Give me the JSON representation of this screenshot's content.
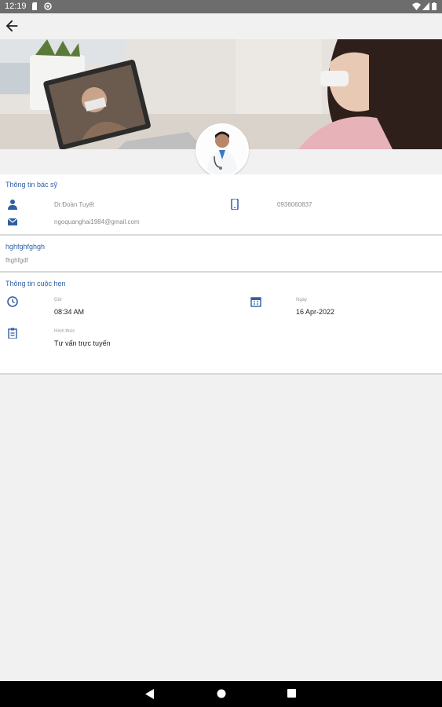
{
  "status_bar": {
    "time": "12:19",
    "icons": [
      "sd-card-icon",
      "data-saver-icon",
      "wifi-icon",
      "signal-icon",
      "battery-icon"
    ]
  },
  "app_bar": {
    "back_icon": "arrow-back-icon"
  },
  "banner": {
    "description_icon": "telemedicine-photo"
  },
  "doctor_info": {
    "title": "Thông tin bác sỹ",
    "name": "Dr.Đoàn Tuyết",
    "phone": "0936060837",
    "email": "ngoquanghai1984@gmail.com"
  },
  "note": {
    "title": "hghfghfghgh",
    "text": "fhghfgdf"
  },
  "appointment": {
    "title": "Thông tin cuộc hẹn",
    "time_label": "Giờ",
    "time_value": "08:34 AM",
    "date_label": "Ngày",
    "date_value": "16 Apr-2022",
    "type_label": "Hình thức",
    "type_value": "Tư vấn trực tuyến"
  },
  "colors": {
    "accent": "#2f5ea8",
    "status_bar": "#6d6d6d",
    "nav_bar": "#000000"
  }
}
